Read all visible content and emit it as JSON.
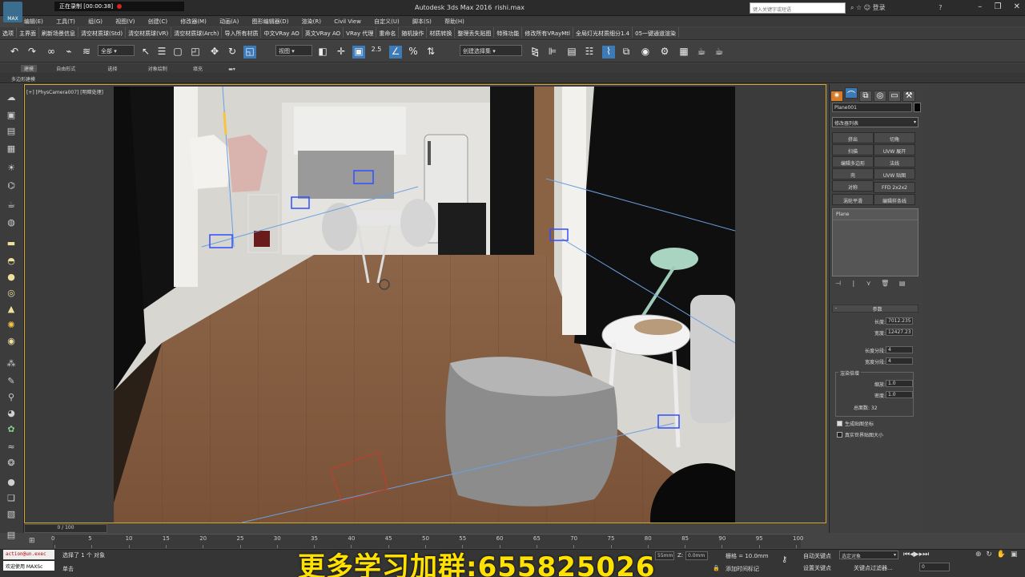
{
  "titlebar": {
    "recording_status": "正在录制 [00:00:38]",
    "app_title": "Autodesk 3ds Max 2016",
    "file_name": "rishi.max",
    "search_placeholder": "键入关键字或短语",
    "user_label": "登录"
  },
  "menu": [
    "编辑(E)",
    "工具(T)",
    "组(G)",
    "视图(V)",
    "创建(C)",
    "修改器(M)",
    "动画(A)",
    "图形编辑器(D)",
    "渲染(R)",
    "Civil View",
    "自定义(U)",
    "脚本(S)",
    "帮助(H)"
  ],
  "plugin_toolbar": [
    "选项",
    "主界面",
    "刷新场景信息",
    "清空材质球(Std)",
    "清空材质球(VR)",
    "清空材质球(Arch)",
    "导入所有材质",
    "中文VRay AO",
    "英文VRay AO",
    "VRay 代理",
    "重命名",
    "随机操作",
    "材质转换",
    "整理丢失贴图",
    "特殊功能",
    "修改所有VRayMtl",
    "全局灯光材质细分1.4",
    "05一键通道渲染"
  ],
  "main_toolbar": {
    "selection_filter": "全部",
    "view_dropdown": "视图",
    "snap_value": "2.5",
    "named_selection": "创建选择集"
  },
  "ribbon": {
    "tabs": [
      "建模",
      "自由形式",
      "选择",
      "对象绘制",
      "填充"
    ],
    "sub_label": "多边形建模"
  },
  "viewport": {
    "label": "[+] [PhysCamera007] [明暗处理]"
  },
  "command_panel": {
    "object_name": "Plane001",
    "modifier_list": "修改器列表",
    "modifier_buttons": [
      "挤出",
      "切角",
      "扫描",
      "UVW 展开",
      "编辑多边形",
      "法线",
      "壳",
      "UVW 贴图",
      "对称",
      "FFD 2x2x2",
      "涡轮平滑",
      "编辑样条线"
    ],
    "stack_items": [
      "Plane"
    ],
    "params_title": "参数",
    "params": [
      {
        "label": "长度:",
        "value": "7012.235"
      },
      {
        "label": "宽度:",
        "value": "12427.23"
      },
      {
        "label": "长度分段:",
        "value": "4"
      },
      {
        "label": "宽度分段:",
        "value": "4"
      }
    ],
    "render_group_title": "渲染倍增",
    "render_params": [
      {
        "label": "缩放:",
        "value": "1.0"
      },
      {
        "label": "密度:",
        "value": "1.0"
      }
    ],
    "total_faces": "总面数: 32",
    "checkboxes": [
      {
        "label": "生成贴图坐标",
        "checked": true
      },
      {
        "label": "真实世界贴图大小",
        "checked": false
      }
    ]
  },
  "timeline": {
    "slider": "0 / 100",
    "ticks": [
      "0",
      "5",
      "10",
      "15",
      "20",
      "25",
      "30",
      "35",
      "40",
      "45",
      "50",
      "55",
      "60",
      "65",
      "70",
      "75",
      "80",
      "85",
      "90",
      "95",
      "100"
    ]
  },
  "statusbar": {
    "maxscript_top": "action@un.exec",
    "maxscript_bottom": "欢迎使用 MAXSc",
    "selection_status": "选择了 1 个 对象",
    "prompt": "单击",
    "y_value": "55mm",
    "z_label": "Z:",
    "z_value": "0.0mm",
    "grid": "栅格 = 10.0mm",
    "add_time_tag": "添加时间标记",
    "auto_key": "自动关键点",
    "set_key": "设置关键点",
    "selected_object": "选定对象",
    "key_filters": "关键点过滤器...",
    "frame": "0"
  },
  "overlay_text": "更多学习加群:655825026",
  "colors": {
    "viewport_border": "#d4a62a",
    "overlay_yellow": "#ffe100",
    "wireframe_blue": "#2f4fff"
  }
}
